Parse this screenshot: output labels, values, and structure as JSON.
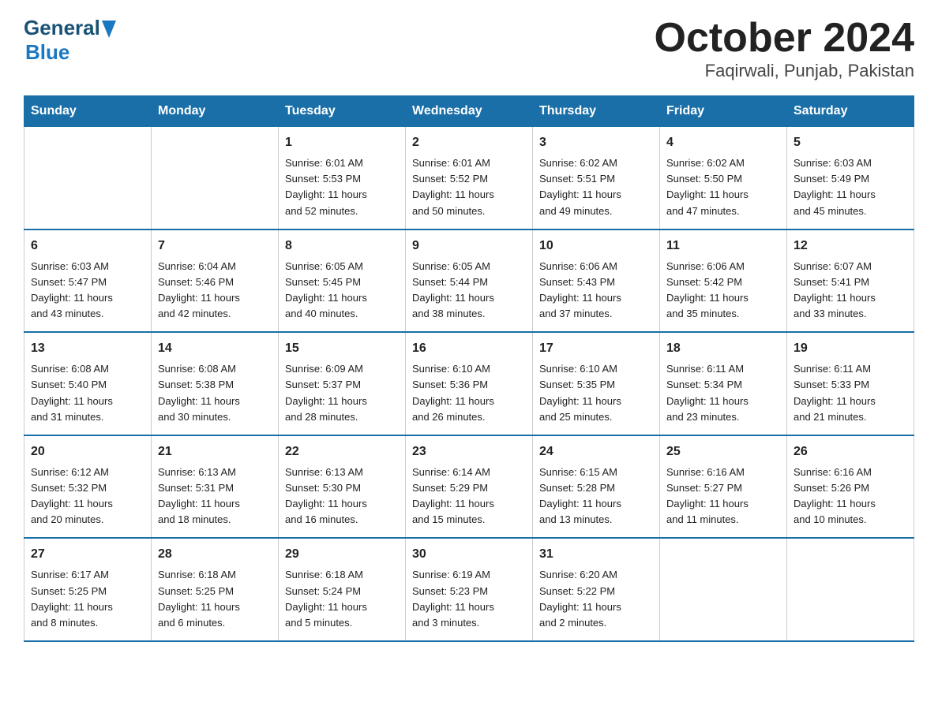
{
  "header": {
    "logo_general": "General",
    "logo_blue": "Blue",
    "title": "October 2024",
    "subtitle": "Faqirwali, Punjab, Pakistan"
  },
  "days_of_week": [
    "Sunday",
    "Monday",
    "Tuesday",
    "Wednesday",
    "Thursday",
    "Friday",
    "Saturday"
  ],
  "weeks": [
    [
      {
        "day": "",
        "info": ""
      },
      {
        "day": "",
        "info": ""
      },
      {
        "day": "1",
        "info": "Sunrise: 6:01 AM\nSunset: 5:53 PM\nDaylight: 11 hours\nand 52 minutes."
      },
      {
        "day": "2",
        "info": "Sunrise: 6:01 AM\nSunset: 5:52 PM\nDaylight: 11 hours\nand 50 minutes."
      },
      {
        "day": "3",
        "info": "Sunrise: 6:02 AM\nSunset: 5:51 PM\nDaylight: 11 hours\nand 49 minutes."
      },
      {
        "day": "4",
        "info": "Sunrise: 6:02 AM\nSunset: 5:50 PM\nDaylight: 11 hours\nand 47 minutes."
      },
      {
        "day": "5",
        "info": "Sunrise: 6:03 AM\nSunset: 5:49 PM\nDaylight: 11 hours\nand 45 minutes."
      }
    ],
    [
      {
        "day": "6",
        "info": "Sunrise: 6:03 AM\nSunset: 5:47 PM\nDaylight: 11 hours\nand 43 minutes."
      },
      {
        "day": "7",
        "info": "Sunrise: 6:04 AM\nSunset: 5:46 PM\nDaylight: 11 hours\nand 42 minutes."
      },
      {
        "day": "8",
        "info": "Sunrise: 6:05 AM\nSunset: 5:45 PM\nDaylight: 11 hours\nand 40 minutes."
      },
      {
        "day": "9",
        "info": "Sunrise: 6:05 AM\nSunset: 5:44 PM\nDaylight: 11 hours\nand 38 minutes."
      },
      {
        "day": "10",
        "info": "Sunrise: 6:06 AM\nSunset: 5:43 PM\nDaylight: 11 hours\nand 37 minutes."
      },
      {
        "day": "11",
        "info": "Sunrise: 6:06 AM\nSunset: 5:42 PM\nDaylight: 11 hours\nand 35 minutes."
      },
      {
        "day": "12",
        "info": "Sunrise: 6:07 AM\nSunset: 5:41 PM\nDaylight: 11 hours\nand 33 minutes."
      }
    ],
    [
      {
        "day": "13",
        "info": "Sunrise: 6:08 AM\nSunset: 5:40 PM\nDaylight: 11 hours\nand 31 minutes."
      },
      {
        "day": "14",
        "info": "Sunrise: 6:08 AM\nSunset: 5:38 PM\nDaylight: 11 hours\nand 30 minutes."
      },
      {
        "day": "15",
        "info": "Sunrise: 6:09 AM\nSunset: 5:37 PM\nDaylight: 11 hours\nand 28 minutes."
      },
      {
        "day": "16",
        "info": "Sunrise: 6:10 AM\nSunset: 5:36 PM\nDaylight: 11 hours\nand 26 minutes."
      },
      {
        "day": "17",
        "info": "Sunrise: 6:10 AM\nSunset: 5:35 PM\nDaylight: 11 hours\nand 25 minutes."
      },
      {
        "day": "18",
        "info": "Sunrise: 6:11 AM\nSunset: 5:34 PM\nDaylight: 11 hours\nand 23 minutes."
      },
      {
        "day": "19",
        "info": "Sunrise: 6:11 AM\nSunset: 5:33 PM\nDaylight: 11 hours\nand 21 minutes."
      }
    ],
    [
      {
        "day": "20",
        "info": "Sunrise: 6:12 AM\nSunset: 5:32 PM\nDaylight: 11 hours\nand 20 minutes."
      },
      {
        "day": "21",
        "info": "Sunrise: 6:13 AM\nSunset: 5:31 PM\nDaylight: 11 hours\nand 18 minutes."
      },
      {
        "day": "22",
        "info": "Sunrise: 6:13 AM\nSunset: 5:30 PM\nDaylight: 11 hours\nand 16 minutes."
      },
      {
        "day": "23",
        "info": "Sunrise: 6:14 AM\nSunset: 5:29 PM\nDaylight: 11 hours\nand 15 minutes."
      },
      {
        "day": "24",
        "info": "Sunrise: 6:15 AM\nSunset: 5:28 PM\nDaylight: 11 hours\nand 13 minutes."
      },
      {
        "day": "25",
        "info": "Sunrise: 6:16 AM\nSunset: 5:27 PM\nDaylight: 11 hours\nand 11 minutes."
      },
      {
        "day": "26",
        "info": "Sunrise: 6:16 AM\nSunset: 5:26 PM\nDaylight: 11 hours\nand 10 minutes."
      }
    ],
    [
      {
        "day": "27",
        "info": "Sunrise: 6:17 AM\nSunset: 5:25 PM\nDaylight: 11 hours\nand 8 minutes."
      },
      {
        "day": "28",
        "info": "Sunrise: 6:18 AM\nSunset: 5:25 PM\nDaylight: 11 hours\nand 6 minutes."
      },
      {
        "day": "29",
        "info": "Sunrise: 6:18 AM\nSunset: 5:24 PM\nDaylight: 11 hours\nand 5 minutes."
      },
      {
        "day": "30",
        "info": "Sunrise: 6:19 AM\nSunset: 5:23 PM\nDaylight: 11 hours\nand 3 minutes."
      },
      {
        "day": "31",
        "info": "Sunrise: 6:20 AM\nSunset: 5:22 PM\nDaylight: 11 hours\nand 2 minutes."
      },
      {
        "day": "",
        "info": ""
      },
      {
        "day": "",
        "info": ""
      }
    ]
  ]
}
